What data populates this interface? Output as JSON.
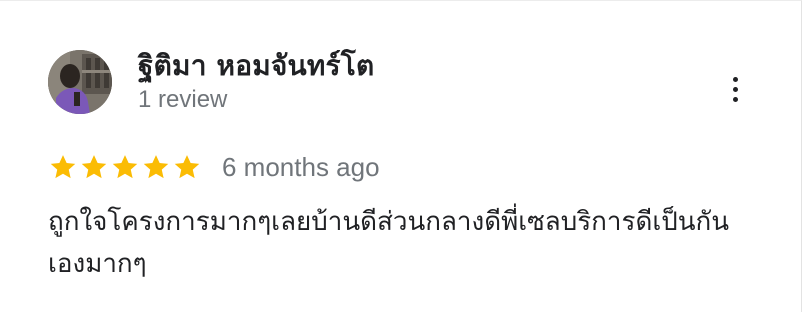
{
  "reviewer": {
    "name": "ฐิติมา หอมจันทร์โต",
    "review_count": "1 review"
  },
  "rating": {
    "stars": 5,
    "max": 5,
    "star_color": "#fbbc04"
  },
  "review": {
    "date": "6 months ago",
    "text": "ถูกใจโครงการมากๆเลยบ้านดีส่วนกลางดีพี่เซลบริการดีเป็นกันเองมากๆ"
  },
  "icons": {
    "more": "more-vert-icon",
    "star": "star-icon",
    "avatar": "avatar-photo"
  }
}
